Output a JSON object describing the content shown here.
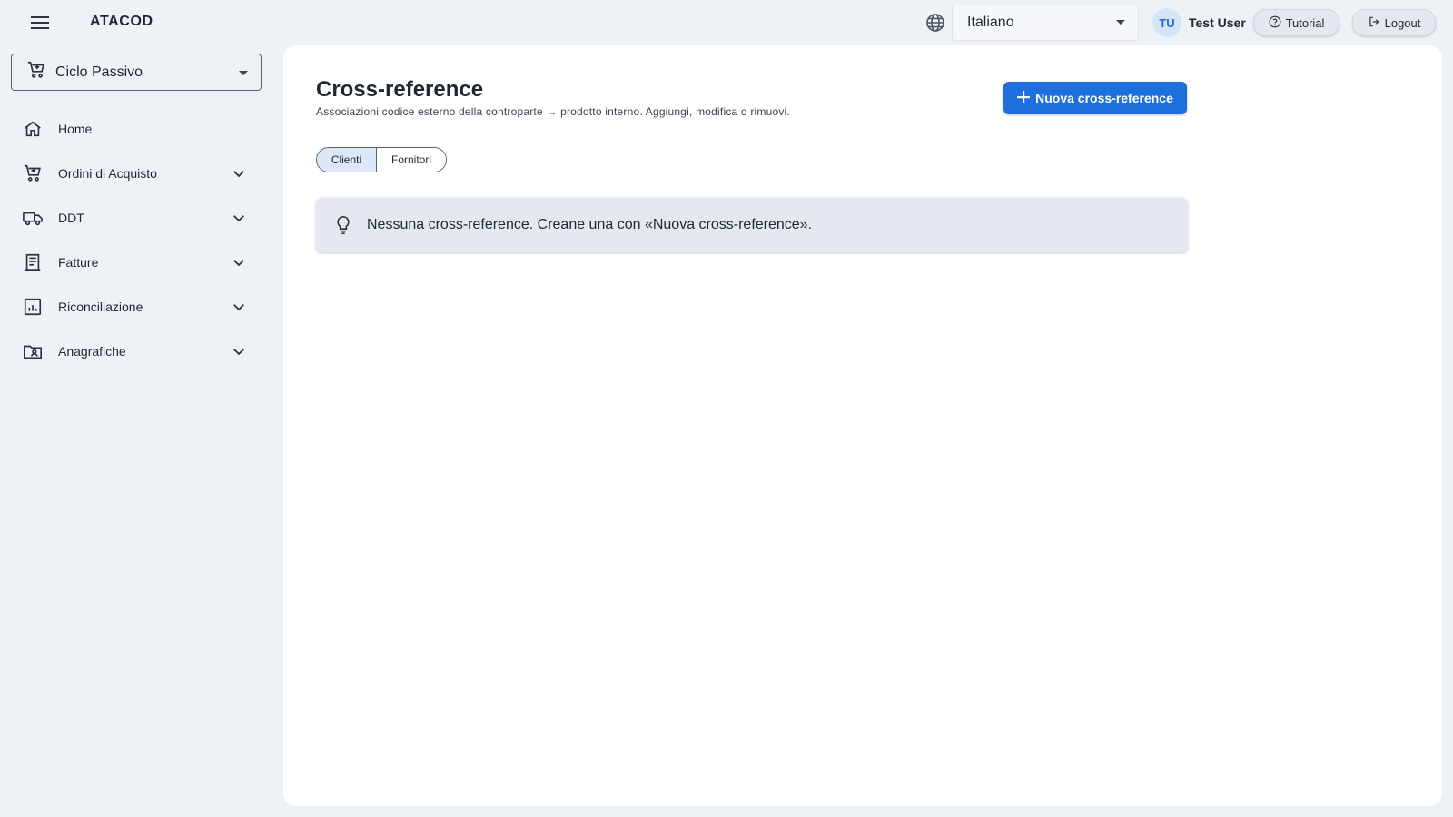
{
  "app": {
    "brand": "ATACOD",
    "menu_icon": "hamburger-menu-icon"
  },
  "header": {
    "language": {
      "icon": "globe-icon",
      "value": "Italiano"
    },
    "user": {
      "initials": "TU",
      "name": "Test User"
    },
    "tutorial_label": "Tutorial",
    "logout_label": "Logout"
  },
  "sidebar": {
    "module_select": {
      "icon": "cart-icon",
      "value": "Ciclo Passivo"
    },
    "items": [
      {
        "label": "Home",
        "icon": "home-icon",
        "expandable": false
      },
      {
        "label": "Ordini di Acquisto",
        "icon": "cart-icon",
        "expandable": true
      },
      {
        "label": "DDT",
        "icon": "truck-icon",
        "expandable": true
      },
      {
        "label": "Fatture",
        "icon": "receipt-icon",
        "expandable": true
      },
      {
        "label": "Riconciliazione",
        "icon": "analytics-icon",
        "expandable": true
      },
      {
        "label": "Anagrafiche",
        "icon": "contact-folder-icon",
        "expandable": true
      }
    ]
  },
  "main": {
    "title": "Cross-reference",
    "subtitle": "Associazioni codice esterno della controparte → prodotto interno. Aggiungi, modifica o rimuovi.",
    "new_button_label": "Nuova cross-reference",
    "tabs": [
      {
        "label": "Clienti",
        "active": true
      },
      {
        "label": "Fornitori",
        "active": false
      }
    ],
    "empty_message": "Nessuna cross-reference. Creane una con «Nuova cross-reference»."
  },
  "colors": {
    "background": "#eef2f6",
    "accent": "#1d6fdc",
    "panel": "#ffffff",
    "info_box": "#e4e9f1"
  }
}
